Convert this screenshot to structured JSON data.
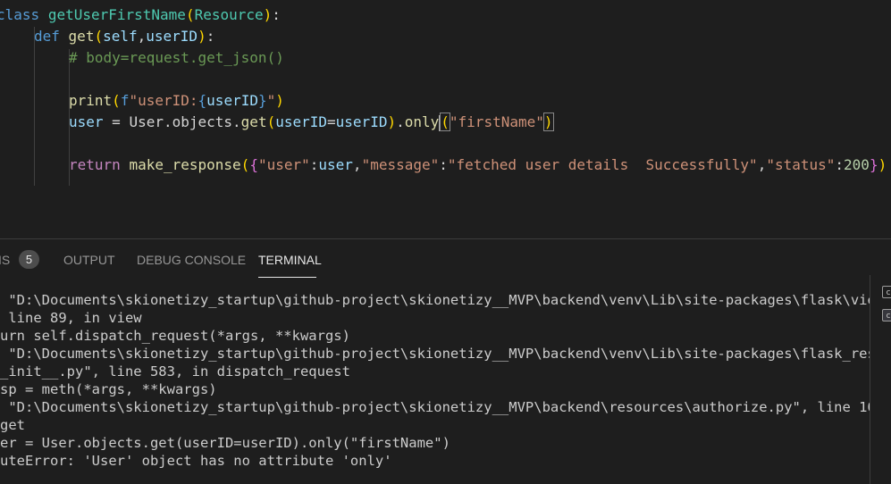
{
  "editor": {
    "line1": {
      "kw": "class",
      "name": "getUserFirstName",
      "open": "(",
      "base": "Resource",
      "close": ")",
      "colon": ":"
    },
    "line2": {
      "kw": "def",
      "name": "get",
      "open": "(",
      "p1": "self",
      "comma": ",",
      "p2": "userID",
      "close": ")",
      "colon": ":"
    },
    "line3": {
      "comment": "# body=request.get_json()"
    },
    "line5": {
      "fn": "print",
      "open": "(",
      "prefix": "f",
      "q1": "\"",
      "text": "userID:",
      "brace_open": "{",
      "var": "userID",
      "brace_close": "}",
      "q2": "\"",
      "close": ")"
    },
    "line6": {
      "lhs": "user",
      "op": " = ",
      "obj": "User.objects.",
      "fn": "get",
      "open": "(",
      "kwarg": "userID",
      "eq": "=",
      "arg": "userID",
      "close": ")",
      "dot": ".",
      "fn2": "only",
      "open2": "(",
      "str": "\"firstName\"",
      "close2": ")"
    },
    "line8": {
      "kw": "return",
      "fn": "make_response",
      "open": "(",
      "brace_open": "{",
      "k1": "\"user\"",
      "c1": ":",
      "v1": "user",
      "sep1": ",",
      "k2": "\"message\"",
      "c2": ":",
      "v2": "\"fetched user details  Successfully\"",
      "sep2": ",",
      "k3": "\"status\"",
      "c3": ":",
      "v3": "200",
      "brace_close": "}",
      "close": ")"
    }
  },
  "panel": {
    "tabs": {
      "problems": "IS",
      "problems_count": "5",
      "output": "OUTPUT",
      "debug": "DEBUG CONSOLE",
      "terminal": "TERMINAL"
    },
    "terminal_lines": [
      " \"D:\\Documents\\skionetizy_startup\\github-project\\skionetizy__MVP\\backend\\venv\\Lib\\site-packages\\flask\\vie",
      " line 89, in view",
      "urn self.dispatch_request(*args, **kwargs)",
      " \"D:\\Documents\\skionetizy_startup\\github-project\\skionetizy__MVP\\backend\\venv\\Lib\\site-packages\\flask_res",
      "_init__.py\", line 583, in dispatch_request",
      "sp = meth(*args, **kwargs)",
      " \"D:\\Documents\\skionetizy_startup\\github-project\\skionetizy__MVP\\backend\\resources\\authorize.py\", line 10",
      "get",
      "er = User.objects.get(userID=userID).only(\"firstName\")",
      "uteError: 'User' object has no attribute 'only'"
    ],
    "sidebar_icon_label": "c"
  },
  "colors": {
    "keyword": "#569cd6",
    "class": "#4ec9b0",
    "function": "#dcdcaa",
    "variable": "#9cdcfe",
    "string": "#ce9178",
    "number": "#b5cea8",
    "comment": "#6a9955",
    "control": "#c586c0"
  }
}
